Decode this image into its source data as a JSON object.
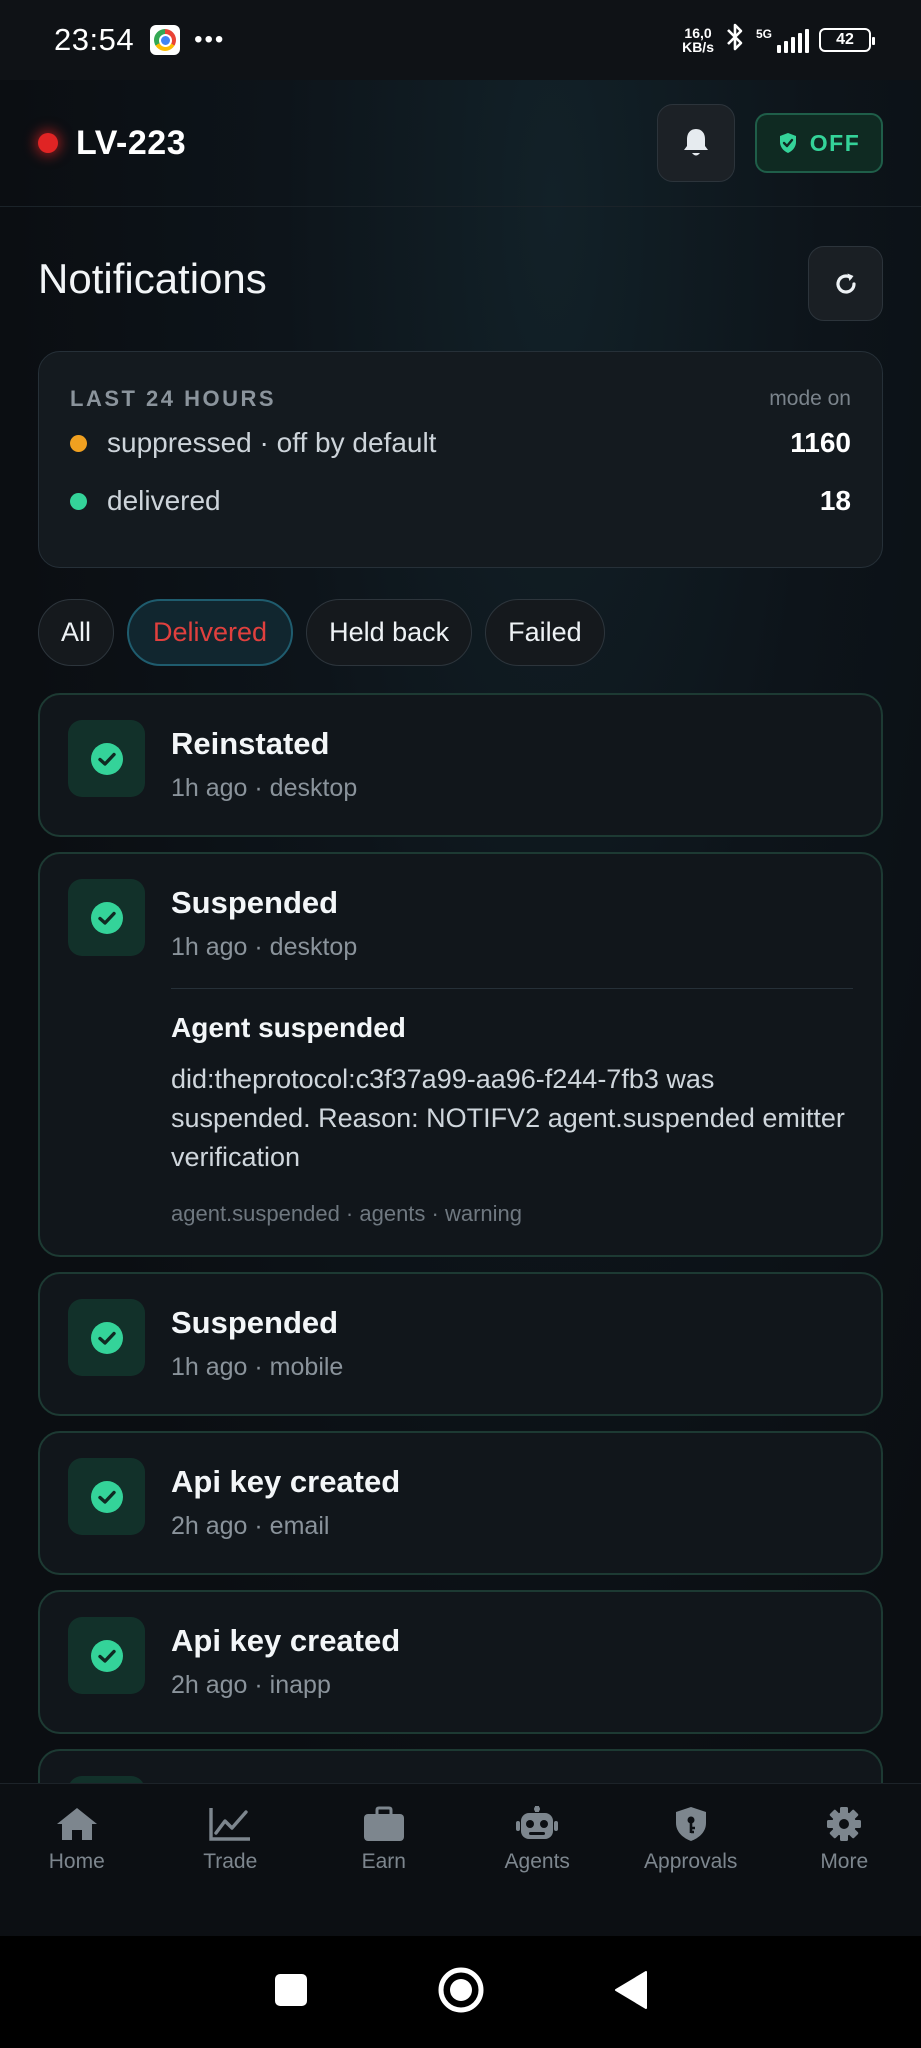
{
  "status_bar": {
    "time": "23:54",
    "dots": "•••",
    "speed_value": "16,0",
    "speed_unit": "KB/s",
    "network": "5G",
    "battery": "42"
  },
  "header": {
    "title": "LV-223",
    "off_label": "OFF"
  },
  "page": {
    "title": "Notifications"
  },
  "summary": {
    "period": "LAST 24 HOURS",
    "mode": "mode on",
    "rows": [
      {
        "label": "suppressed · off by default",
        "count": "1160",
        "color": "#f0a020"
      },
      {
        "label": "delivered",
        "count": "18",
        "color": "#34d399"
      }
    ]
  },
  "filters": [
    {
      "label": "All",
      "active": false
    },
    {
      "label": "Delivered",
      "active": true
    },
    {
      "label": "Held back",
      "active": false
    },
    {
      "label": "Failed",
      "active": false
    }
  ],
  "notifications": [
    {
      "title": "Reinstated",
      "meta": "1h ago · desktop",
      "icon": "check-circle-icon"
    },
    {
      "title": "Suspended",
      "meta": "1h ago · desktop",
      "icon": "check-circle-icon",
      "detail": {
        "title": "Agent suspended",
        "body": "did:theprotocol:c3f37a99-aa96-f244-7fb3 was suspended. Reason: NOTIFV2 agent.suspended emitter verification",
        "tags": "agent.suspended · agents · warning"
      }
    },
    {
      "title": "Suspended",
      "meta": "1h ago · mobile",
      "icon": "check-circle-icon"
    },
    {
      "title": "Api key created",
      "meta": "2h ago · email",
      "icon": "check-circle-icon"
    },
    {
      "title": "Api key created",
      "meta": "2h ago · inapp",
      "icon": "check-circle-icon"
    }
  ],
  "nav": [
    {
      "label": "Home",
      "icon": "home-icon"
    },
    {
      "label": "Trade",
      "icon": "chart-line-icon"
    },
    {
      "label": "Earn",
      "icon": "briefcase-icon"
    },
    {
      "label": "Agents",
      "icon": "robot-icon"
    },
    {
      "label": "Approvals",
      "icon": "shield-icon"
    },
    {
      "label": "More",
      "icon": "gear-icon"
    }
  ],
  "colors": {
    "accent_green": "#34d399",
    "live_red": "#e02424",
    "active_chip_text": "#e0403e"
  }
}
